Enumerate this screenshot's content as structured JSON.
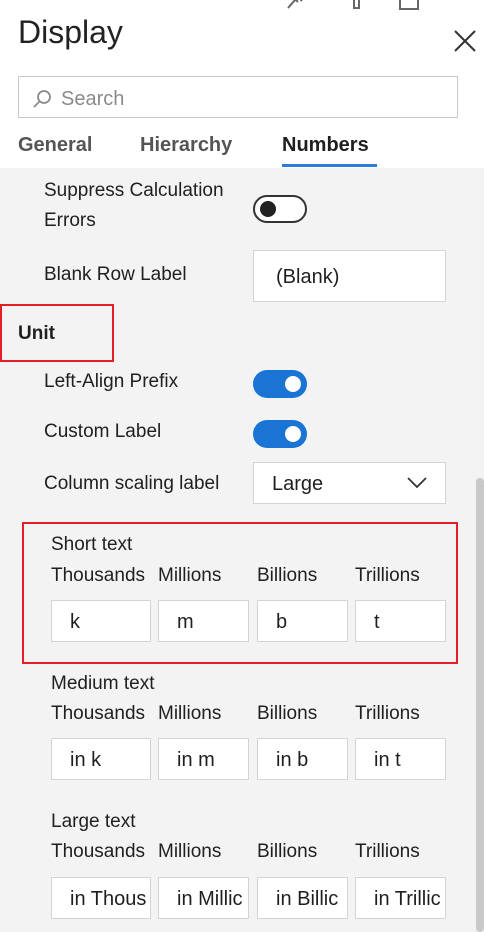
{
  "header": {
    "title": "Display"
  },
  "search": {
    "placeholder": "Search"
  },
  "tabs": [
    {
      "label": "General",
      "active": false
    },
    {
      "label": "Hierarchy",
      "active": false
    },
    {
      "label": "Numbers",
      "active": true
    }
  ],
  "settings": {
    "suppress_errors": {
      "label_line1": "Suppress Calculation",
      "label_line2": "Errors",
      "on": false
    },
    "blank_row": {
      "label": "Blank Row Label",
      "value": "(Blank)"
    }
  },
  "unit": {
    "heading": "Unit",
    "left_align_prefix": {
      "label": "Left-Align Prefix",
      "on": true
    },
    "custom_label": {
      "label": "Custom Label",
      "on": true
    },
    "column_scaling": {
      "label": "Column scaling label",
      "value": "Large"
    },
    "columns": [
      "Thousands",
      "Millions",
      "Billions",
      "Trillions"
    ],
    "short_text": {
      "label": "Short text",
      "values": [
        "k",
        "m",
        "b",
        "t"
      ]
    },
    "medium_text": {
      "label": "Medium text",
      "values": [
        "in k",
        "in m",
        "in b",
        "in t"
      ]
    },
    "large_text": {
      "label": "Large text",
      "values": [
        "in Thous",
        "in Millic",
        "in Billic",
        "in Trillic"
      ]
    }
  },
  "colors": {
    "accent": "#1a74d4",
    "highlight": "#e31e24",
    "tab_underline": "#2b7cd3"
  }
}
